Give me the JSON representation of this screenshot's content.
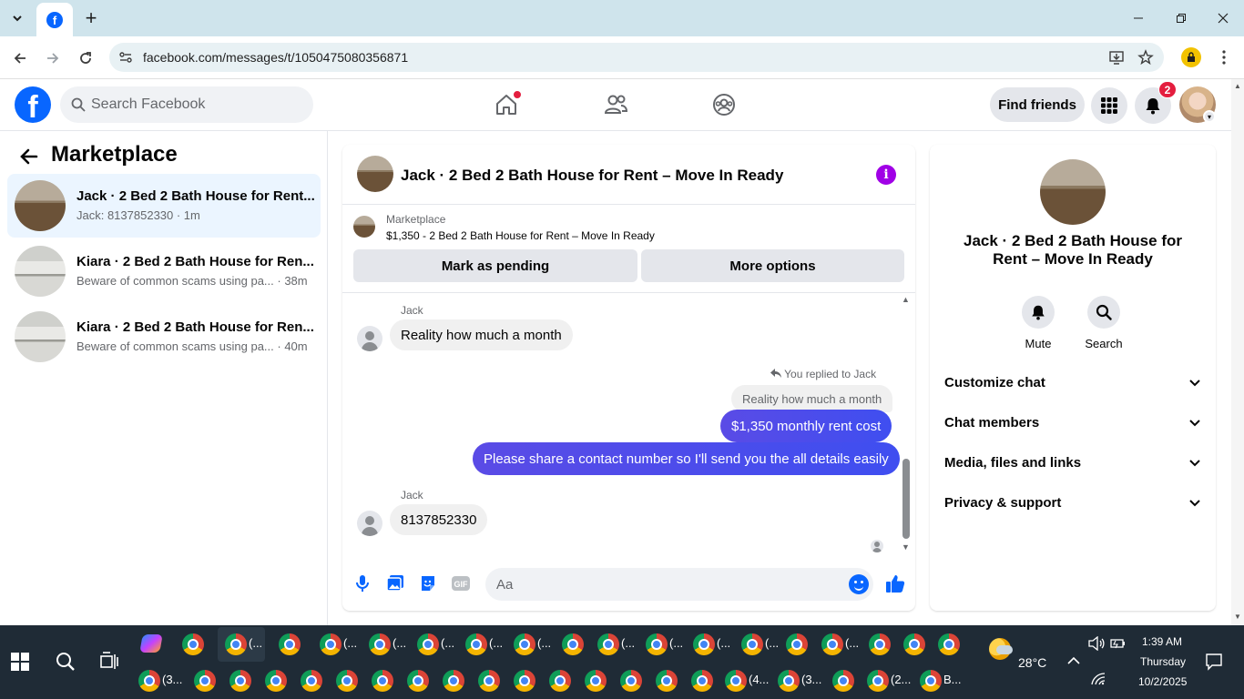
{
  "browser": {
    "url": "facebook.com/messages/t/1050475080356871"
  },
  "fb": {
    "search_placeholder": "Search Facebook",
    "find_friends": "Find friends",
    "notif_count": "2",
    "brand_color": "#0866ff"
  },
  "left": {
    "title": "Marketplace",
    "conversations": [
      {
        "name": "Jack · 2 Bed 2 Bath House for Rent...",
        "sub": "Jack: 8137852330 · 1m"
      },
      {
        "name": "Kiara · 2 Bed 2 Bath House for Ren...",
        "sub": "Beware of common scams using pa... · 38m"
      },
      {
        "name": "Kiara · 2 Bed 2 Bath House for Ren...",
        "sub": "Beware of common scams using pa... · 40m"
      }
    ]
  },
  "chat": {
    "title": "Jack · 2 Bed 2 Bath House for Rent – Move In Ready",
    "marketplace_label": "Marketplace",
    "listing": "$1,350 - 2 Bed 2 Bath House for Rent – Move In Ready",
    "mark_pending": "Mark as pending",
    "more_options": "More options",
    "messages": {
      "m1_sender": "Jack",
      "m1_text": "Reality how much a month",
      "reply_note": "You replied to Jack",
      "reply_quote": "Reality how much a month",
      "m2_text": "$1,350 monthly rent cost",
      "m3_text": "Please share a contact number so I'll send you the all details easily",
      "m4_sender": "Jack",
      "m4_text": "8137852330"
    },
    "composer_placeholder": "Aa",
    "outgoing_color": "#4e46e5"
  },
  "right": {
    "title": "Jack · 2 Bed 2 Bath House for Rent – Move In Ready",
    "mute": "Mute",
    "search": "Search",
    "sections": [
      "Customize chat",
      "Chat members",
      "Media, files and links",
      "Privacy & support"
    ]
  },
  "taskbar": {
    "labels": {
      "t1": "(...",
      "t2": "(...",
      "t3": "(...",
      "t4": "(...",
      "t5": "(...",
      "t6": "(...",
      "t7": "(...",
      "t8": "(...",
      "t9": "(...",
      "t10": "(...",
      "t11": "(...",
      "b1": "(3...",
      "b2": "(4...",
      "b3": "(3...",
      "b4": "(2...",
      "b5": "B..."
    },
    "weather": "28°C",
    "time": "1:39 AM",
    "day": "Thursday",
    "date": "10/2/2025"
  }
}
